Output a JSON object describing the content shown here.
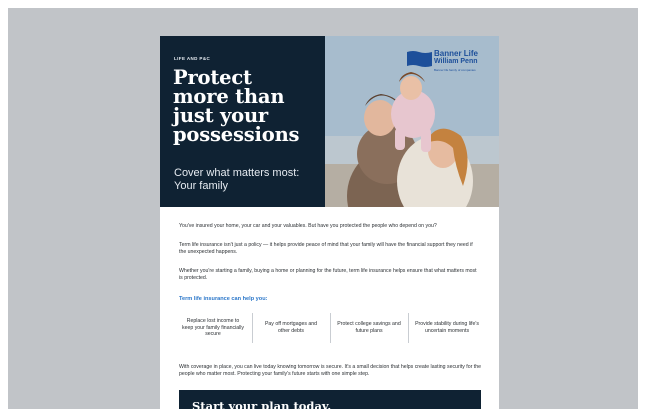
{
  "flyer": {
    "eyebrow": "LIFE AND P&C",
    "headline_lines": [
      "Protect",
      "more than",
      "just your",
      "possessions"
    ],
    "subhead_lines": [
      "Cover what matters most:",
      "Your family"
    ],
    "logo": {
      "line1": "Banner Life",
      "line2": "William Penn",
      "line3": "Banner life family of companies",
      "color": "#1d4f9a"
    },
    "paragraphs": [
      "You've insured your home, your car and your valuables. But have you protected the people who depend on you?",
      "Term life insurance isn't just a policy — it helps provide peace of mind that your family will have the financial support they need if the unexpected happens.",
      "Whether you're starting a family, buying a home or planning for the future, term life insurance helps ensure that what matters most is protected."
    ],
    "help_heading": "Term life insurance can help you:",
    "benefits": [
      "Replace lost income to keep your family financially secure",
      "Pay off mortgages and other debts",
      "Protect college savings and future plans",
      "Provide stability during life's uncertain moments"
    ],
    "closing": "With coverage in place, you can live today knowing tomorrow is secure. It's a small decision that helps create lasting security for the people who matter most. Protecting your family's future starts with one simple step.",
    "cta": "Start your plan today.",
    "colors": {
      "navy": "#0f2233",
      "accent_blue": "#2a76c9",
      "page_gray": "#c1c4c8"
    }
  }
}
